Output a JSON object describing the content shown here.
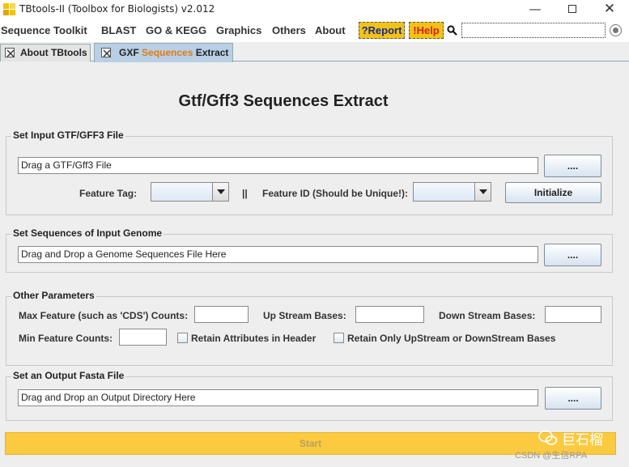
{
  "window": {
    "title": "TBtools-II (Toolbox for Biologists) v2.012",
    "minimize_glyph": "—",
    "close_glyph": "✕"
  },
  "menu": {
    "items": [
      "Sequence Toolkit",
      "BLAST",
      "GO & KEGG",
      "Graphics",
      "Others",
      "About"
    ],
    "report_label": "?Report",
    "help_label": "!Help",
    "search_value": "",
    "report_color": "#1c2a8a",
    "help_color": "#d42020",
    "highlight_color": "#f2c316"
  },
  "tabs": [
    {
      "label": "About TBtools",
      "active": false
    },
    {
      "label_prefix": "GXF ",
      "label_accent": "Sequences",
      "label_suffix": " Extract",
      "active": true
    }
  ],
  "heading": "Gtf/Gff3 Sequences Extract",
  "gtf_section": {
    "title": "Set Input GTF/GFF3 File",
    "file_field": "Drag a GTF/Gff3 File",
    "browse_label": "....",
    "feature_tag_label": "Feature Tag:",
    "feature_tag_value": "",
    "separator": "||",
    "feature_id_label": "Feature ID (Should be Unique!):",
    "feature_id_value": "",
    "initialize_label": "Initialize"
  },
  "genome_section": {
    "title": "Set Sequences of Input Genome",
    "file_field": "Drag and Drop a Genome Sequences File Here",
    "browse_label": "...."
  },
  "params_section": {
    "title": "Other Parameters",
    "max_feature_label": "Max Feature (such as 'CDS') Counts:",
    "max_feature_value": "",
    "upstream_label": "Up Stream Bases:",
    "upstream_value": "",
    "downstream_label": "Down Stream Bases:",
    "downstream_value": "",
    "min_feature_label": "Min Feature Counts:",
    "min_feature_value": "",
    "retain_attr_label": "Retain Attributes in Header",
    "retain_attr_checked": false,
    "retain_only_label": "Retain Only UpStream or DownStream Bases",
    "retain_only_checked": false
  },
  "output_section": {
    "title": "Set an Output Fasta File",
    "file_field": "Drag and Drop an Output Directory Here",
    "browse_label": "...."
  },
  "start": {
    "label": "Start",
    "color": "#fbca3f"
  },
  "watermark": {
    "name": "巨石榴",
    "site": "CSDN @生信RPA"
  }
}
